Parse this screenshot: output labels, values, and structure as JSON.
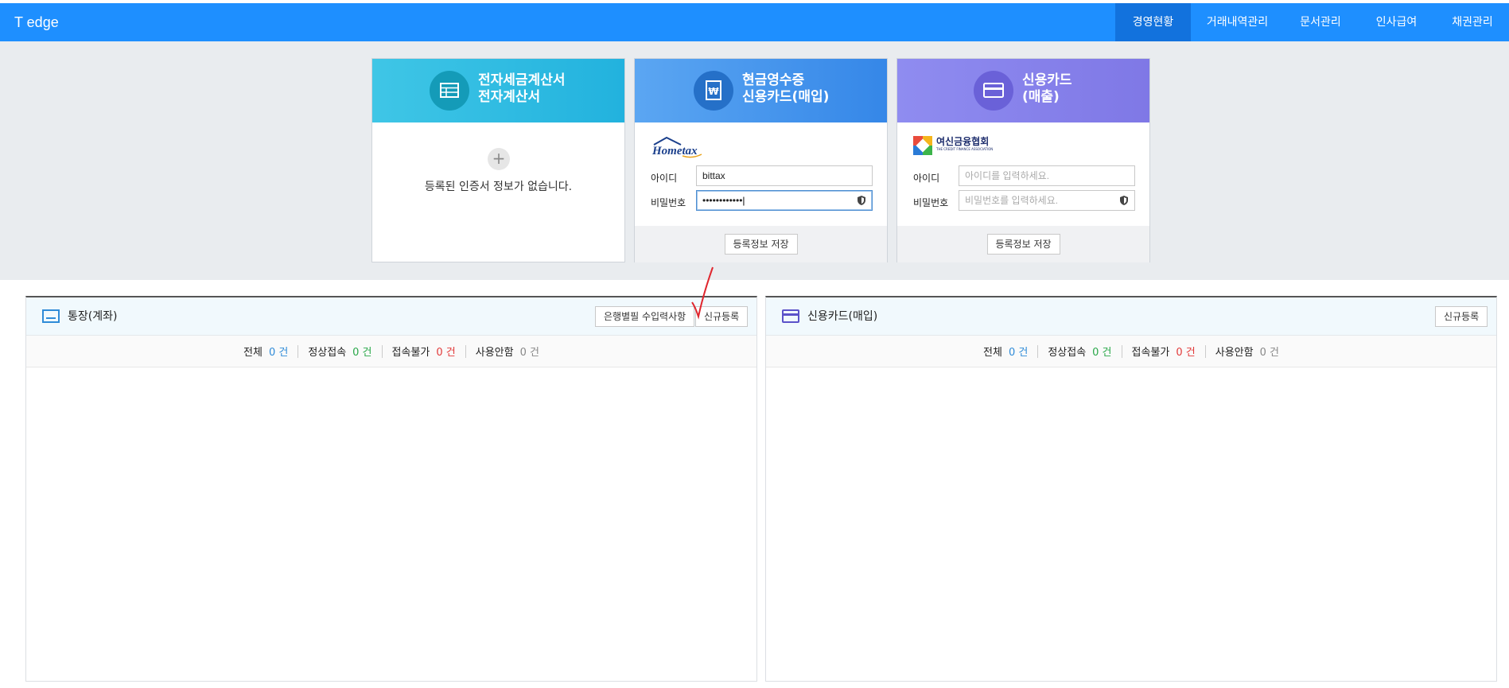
{
  "app": {
    "brand": "T edge"
  },
  "nav": {
    "items": [
      {
        "label": "경영현황",
        "active": true
      },
      {
        "label": "거래내역관리"
      },
      {
        "label": "문서관리"
      },
      {
        "label": "인사급여"
      },
      {
        "label": "채권관리"
      }
    ]
  },
  "cards": {
    "tax_invoice": {
      "title_line1": "전자세금계산서",
      "title_line2": "전자계산서",
      "icon": "invoice-table-icon",
      "empty_message": "등록된 인증서 정보가 없습니다.",
      "add_icon": "plus-icon"
    },
    "cash_receipt": {
      "title_line1": "현금영수증",
      "title_line2": "신용카드(매입)",
      "icon": "won-receipt-icon",
      "logo": "Hometax",
      "id_label": "아이디",
      "id_value": "bittax",
      "pw_label": "비밀번호",
      "pw_value": "••••••••••••",
      "save_label": "등록정보 저장"
    },
    "credit_card": {
      "title_line1": "신용카드",
      "title_line2": "(매출)",
      "icon": "credit-card-icon",
      "logo": "여신금융협회",
      "logo_sub": "THE CREDIT FINANCE ASSOCIATION",
      "id_label": "아이디",
      "id_placeholder": "아이디를 입력하세요.",
      "pw_label": "비밀번호",
      "pw_placeholder": "비밀번호를 입력하세요.",
      "save_label": "등록정보 저장"
    }
  },
  "panels": {
    "bankbook": {
      "title": "통장(계좌)",
      "btn_required": "은행별필 수입력사항",
      "btn_new": "신규등록",
      "stats": [
        {
          "label": "전체",
          "value": "0 건",
          "color": "blue"
        },
        {
          "label": "정상접속",
          "value": "0 건",
          "color": "green"
        },
        {
          "label": "접속불가",
          "value": "0 건",
          "color": "red"
        },
        {
          "label": "사용안함",
          "value": "0 건",
          "color": "gray"
        }
      ]
    },
    "card_purchase": {
      "title": "신용카드(매입)",
      "btn_new": "신규등록",
      "stats": [
        {
          "label": "전체",
          "value": "0 건",
          "color": "blue"
        },
        {
          "label": "정상접속",
          "value": "0 건",
          "color": "green"
        },
        {
          "label": "접속불가",
          "value": "0 건",
          "color": "red"
        },
        {
          "label": "사용안함",
          "value": "0 건",
          "color": "gray"
        }
      ]
    }
  },
  "colors": {
    "topbar": "#1e8fff",
    "nav_active": "#1272dd",
    "card1": "#22b2de",
    "card2": "#3587e8",
    "card3": "#7f78e6",
    "annotation": "#e0262e"
  }
}
